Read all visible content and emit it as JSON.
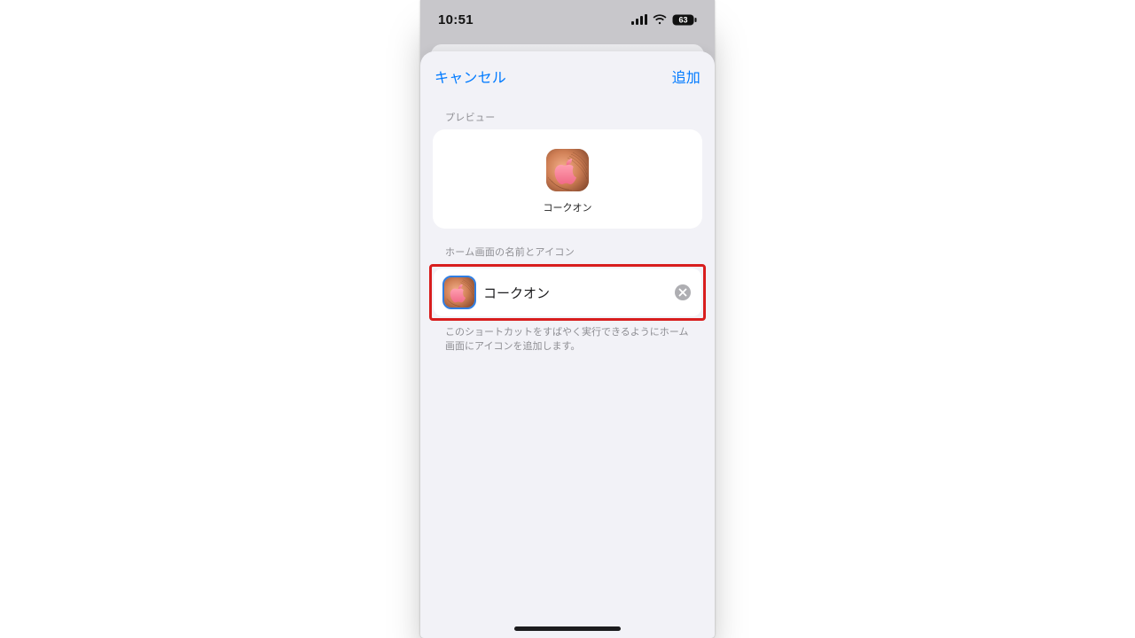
{
  "statusbar": {
    "time": "10:51",
    "battery": "63"
  },
  "sheet": {
    "cancel_label": "キャンセル",
    "add_label": "追加",
    "preview_section_label": "プレビュー",
    "preview_app_label": "コークオン",
    "name_section_label": "ホーム画面の名前とアイコン",
    "name_value": "コークオン",
    "helper_text": "このショートカットをすばやく実行できるようにホーム画面にアイコンを追加します。"
  }
}
